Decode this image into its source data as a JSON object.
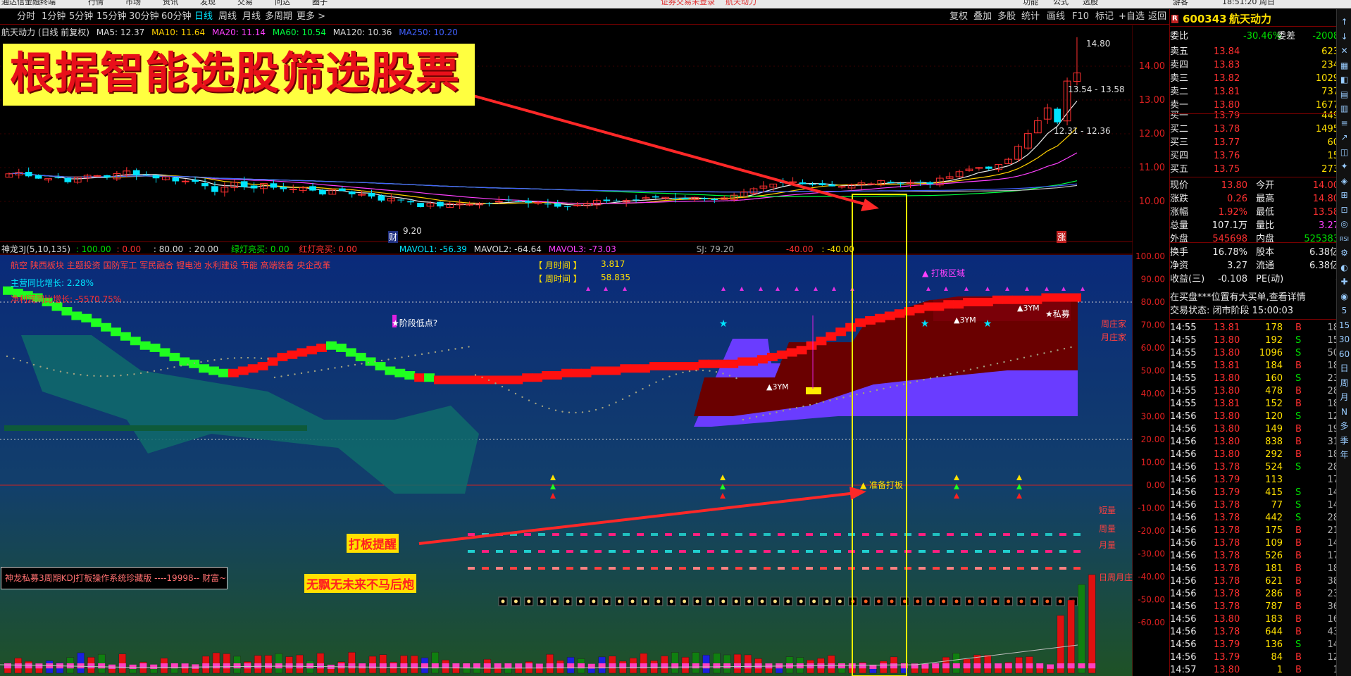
{
  "menubar": {
    "app_name": "通达信金融终端",
    "items": [
      "行情",
      "市场",
      "资讯",
      "发现",
      "交易",
      "问达",
      "圈子"
    ],
    "login_notice": "证券交易未登录",
    "stock_name": "航天动力",
    "right_items": [
      "功能",
      "公式",
      "选股",
      "游客"
    ],
    "time": "18:51:20 周日"
  },
  "timeframes": {
    "items": [
      "分时",
      "1分钟",
      "5分钟",
      "15分钟",
      "30分钟",
      "60分钟",
      "日线",
      "周线",
      "月线",
      "多周期",
      "更多 >"
    ],
    "active": "日线"
  },
  "toolbar": {
    "items": [
      "复权",
      "叠加",
      "多股",
      "统计",
      "画线",
      "F10",
      "标记",
      "+自选",
      "返回"
    ]
  },
  "main_legend": {
    "title": "航天动力 (日线 前复权)",
    "ma5": "MA5: 12.37",
    "ma10": "MA10: 11.64",
    "ma20": "MA20: 11.14",
    "ma60": "MA60: 10.54",
    "ma120": "MA120: 10.36",
    "ma250": "MA250: 10.20"
  },
  "banner": {
    "text": "根据智能选股筛选股票"
  },
  "price_axis": [
    "14.00",
    "13.00",
    "12.00",
    "11.00",
    "10.00"
  ],
  "price_labels": {
    "high": "14.80",
    "range1": "13.54 - 13.58",
    "range2": "12.31 - 12.36",
    "low": "9.20",
    "mark_cai": "财",
    "mark_zhang": "涨"
  },
  "indicator_legend": {
    "name": "神龙3J(5,10,135)",
    "v1": ": 100.00",
    "v2": ": 0.00",
    "v3": ": 80.00",
    "v4": ": 20.00",
    "green_label": "绿灯亮买: 0.00",
    "red_label": "红灯亮买: 0.00",
    "mavol1": "MAVOL1: -56.39",
    "mavol2": "MAVOL2: -64.64",
    "mavol3": "MAVOL3: -73.03",
    "sj": "SJ: 79.20",
    "neg40a": "-40.00",
    "neg40b": ": -40.00"
  },
  "indicator_axis": [
    "100.00",
    "90.00",
    "80.00",
    "70.00",
    "60.00",
    "50.00",
    "40.00",
    "30.00",
    "20.00",
    "10.00",
    "0.00",
    "-10.00",
    "-20.00",
    "-30.00",
    "-40.00",
    "-50.00",
    "-60.00"
  ],
  "indicator_text": {
    "concepts": "航空 陕西板块 主题投资 国防军工 军民融合 锂电池 水利建设 节能 高端装备 央企改革",
    "revenue_growth": "主营同比增长: 2.28%",
    "profit_growth": "净利润同比增长: -5570.75%",
    "month_time_label": "【 月时间 】",
    "month_time_value": "3.817",
    "week_time_label": "【 周时间 】",
    "week_time_value": "58.835",
    "stage_low": "★阶段低点?",
    "daban_zone": "▲ 打板区域",
    "ym1": "▲3YM",
    "ym2": "▲3YM",
    "ym3": "▲3YM",
    "simu": "★私募",
    "zhouzhuangjia": "周庄家",
    "yuezhuangjia": "月庄家",
    "prepare": "▲ 准备打板",
    "short_qty": "短量",
    "week_qty": "周量",
    "month_qty": "月量",
    "day_week_month": "日周月庄",
    "daban_alert": "打板提醒",
    "slogan": "无飘无未来不马后炮",
    "system_name": "神龙私募3周期KDJ打板操作系统珍藏版 ----19998-- 财富~"
  },
  "quote": {
    "code": "600343",
    "name": "航天动力",
    "weibi_label": "委比",
    "weibi": "-30.46%",
    "weicha_label": "委差",
    "weicha": "-2008",
    "asks": [
      {
        "label": "卖五",
        "price": "13.84",
        "vol": "623"
      },
      {
        "label": "卖四",
        "price": "13.83",
        "vol": "234"
      },
      {
        "label": "卖三",
        "price": "13.82",
        "vol": "1029"
      },
      {
        "label": "卖二",
        "price": "13.81",
        "vol": "737"
      },
      {
        "label": "卖一",
        "price": "13.80",
        "vol": "1677"
      }
    ],
    "bids": [
      {
        "label": "买一",
        "price": "13.79",
        "vol": "449"
      },
      {
        "label": "买二",
        "price": "13.78",
        "vol": "1495"
      },
      {
        "label": "买三",
        "price": "13.77",
        "vol": "60"
      },
      {
        "label": "买四",
        "price": "13.76",
        "vol": "15"
      },
      {
        "label": "买五",
        "price": "13.75",
        "vol": "273"
      }
    ],
    "stats": [
      {
        "l1": "现价",
        "v1": "13.80",
        "l2": "今开",
        "v2": "14.00"
      },
      {
        "l1": "涨跌",
        "v1": "0.26",
        "l2": "最高",
        "v2": "14.80"
      },
      {
        "l1": "涨幅",
        "v1": "1.92%",
        "l2": "最低",
        "v2": "13.58"
      },
      {
        "l1": "总量",
        "v1": "107.1万",
        "l2": "量比",
        "v2": "3.27"
      },
      {
        "l1": "外盘",
        "v1": "545698",
        "l2": "内盘",
        "v2": "525383"
      },
      {
        "l1": "换手",
        "v1": "16.78%",
        "l2": "股本",
        "v2": "6.38亿"
      },
      {
        "l1": "净资",
        "v1": "3.27",
        "l2": "流通",
        "v2": "6.38亿"
      },
      {
        "l1": "收益(三)",
        "v1": "-0.108",
        "l2": "PE(动)",
        "v2": "-"
      }
    ],
    "notice": "在买盘***位置有大买单,查看详情",
    "status": "交易状态: 闭市阶段 15:00:03"
  },
  "ticks": [
    {
      "t": "14:55",
      "p": "13.81",
      "v": "178",
      "s": "B",
      "n": "18"
    },
    {
      "t": "14:55",
      "p": "13.80",
      "v": "192",
      "s": "S",
      "n": "15"
    },
    {
      "t": "14:55",
      "p": "13.80",
      "v": "1096",
      "s": "S",
      "n": "50"
    },
    {
      "t": "14:55",
      "p": "13.81",
      "v": "184",
      "s": "B",
      "n": "18"
    },
    {
      "t": "14:55",
      "p": "13.80",
      "v": "160",
      "s": "S",
      "n": "23"
    },
    {
      "t": "14:55",
      "p": "13.80",
      "v": "478",
      "s": "B",
      "n": "28"
    },
    {
      "t": "14:55",
      "p": "13.81",
      "v": "152",
      "s": "B",
      "n": "18"
    },
    {
      "t": "14:56",
      "p": "13.80",
      "v": "120",
      "s": "S",
      "n": "12"
    },
    {
      "t": "14:56",
      "p": "13.80",
      "v": "149",
      "s": "B",
      "n": "19"
    },
    {
      "t": "14:56",
      "p": "13.80",
      "v": "838",
      "s": "B",
      "n": "31"
    },
    {
      "t": "14:56",
      "p": "13.80",
      "v": "292",
      "s": "B",
      "n": "18"
    },
    {
      "t": "14:56",
      "p": "13.78",
      "v": "524",
      "s": "S",
      "n": "28"
    },
    {
      "t": "14:56",
      "p": "13.79",
      "v": "113",
      "s": "",
      "n": "17"
    },
    {
      "t": "14:56",
      "p": "13.79",
      "v": "415",
      "s": "S",
      "n": "14"
    },
    {
      "t": "14:56",
      "p": "13.78",
      "v": "77",
      "s": "S",
      "n": "14"
    },
    {
      "t": "14:56",
      "p": "13.78",
      "v": "442",
      "s": "S",
      "n": "28"
    },
    {
      "t": "14:56",
      "p": "13.78",
      "v": "175",
      "s": "B",
      "n": "21"
    },
    {
      "t": "14:56",
      "p": "13.78",
      "v": "109",
      "s": "B",
      "n": "14"
    },
    {
      "t": "14:56",
      "p": "13.78",
      "v": "526",
      "s": "B",
      "n": "17"
    },
    {
      "t": "14:56",
      "p": "13.78",
      "v": "181",
      "s": "B",
      "n": "18"
    },
    {
      "t": "14:56",
      "p": "13.78",
      "v": "621",
      "s": "B",
      "n": "38"
    },
    {
      "t": "14:56",
      "p": "13.78",
      "v": "286",
      "s": "B",
      "n": "23"
    },
    {
      "t": "14:56",
      "p": "13.78",
      "v": "787",
      "s": "B",
      "n": "36"
    },
    {
      "t": "14:56",
      "p": "13.80",
      "v": "183",
      "s": "B",
      "n": "16"
    },
    {
      "t": "14:56",
      "p": "13.78",
      "v": "644",
      "s": "B",
      "n": "43"
    },
    {
      "t": "14:56",
      "p": "13.79",
      "v": "136",
      "s": "S",
      "n": "14"
    },
    {
      "t": "14:56",
      "p": "13.79",
      "v": "84",
      "s": "B",
      "n": "12"
    },
    {
      "t": "14:57",
      "p": "13.80",
      "v": "1",
      "s": "B",
      "n": "1"
    }
  ],
  "right_tools": [
    "↑",
    "↓",
    "✕",
    "▦",
    "◧",
    "▤",
    "▥",
    "≡",
    "↗",
    "◫",
    "✦",
    "◈",
    "⊞",
    "⊡",
    "◎",
    "RSI",
    "⚙",
    "◐",
    "✚",
    "◉",
    "5",
    "15",
    "30",
    "60",
    "日",
    "周",
    "月",
    "N",
    "多",
    "季",
    "年"
  ],
  "colors": {
    "up": "#ff3030",
    "down": "#00e000",
    "accent": "#00e5ff",
    "banner_bg": "#ffff40",
    "banner_text": "#e8101a",
    "highlight": "#ffff00"
  }
}
